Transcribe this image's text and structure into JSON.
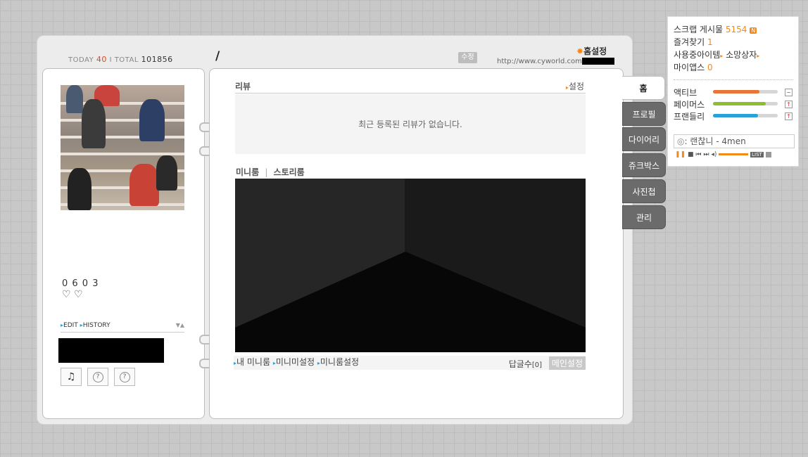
{
  "counter": {
    "today_label": "TODAY",
    "today_value": "40",
    "separator": "I",
    "total_label": "TOTAL",
    "total_value": "101856"
  },
  "header": {
    "slash": "/",
    "edit_label": "수정",
    "url": "http://www.cyworld.com",
    "home_setting_label": "홈설정"
  },
  "profile": {
    "mood_number": "0 6 0 3",
    "mood_hearts": "♡ ♡",
    "edit_label": "EDIT",
    "history_label": "HISTORY",
    "toggle": "▼▲"
  },
  "review": {
    "title": "리뷰",
    "setting_label": "설정",
    "empty_message": "최근 등록된 리뷰가 없습니다."
  },
  "miniroom": {
    "tab_miniroom": "미니룸",
    "divider": "|",
    "tab_storyroom": "스토리룸",
    "link_my_miniroom": "내 미니룸",
    "link_minimi_setting": "미니미설정",
    "link_miniroom_setting": "미니룸설정",
    "reply_count_label": "답글수",
    "reply_count": "[0]",
    "main_setting_label": "메인설정"
  },
  "tabs": [
    {
      "label": "홈",
      "active": true
    },
    {
      "label": "프로필",
      "active": false
    },
    {
      "label": "다이어리",
      "active": false
    },
    {
      "label": "쥬크박스",
      "active": false
    },
    {
      "label": "사진첩",
      "active": false
    },
    {
      "label": "관리",
      "active": false
    }
  ],
  "widget": {
    "scrap_label": "스크랩 게시물",
    "scrap_count": "5154",
    "new_badge": "N",
    "favorites_label": "즐겨찾기",
    "favorites_count": "1",
    "items_label": "사용중아이템",
    "wishbox_label": "소망상자",
    "myapps_label": "마이앱스",
    "myapps_count": "0",
    "stats": [
      {
        "label": "액티브",
        "level": 0.72,
        "color": "#e8743a",
        "button": "−"
      },
      {
        "label": "페이머스",
        "level": 0.82,
        "color": "#8cbf2e",
        "button": "↑"
      },
      {
        "label": "프랜들리",
        "level": 0.7,
        "color": "#2aa0d8",
        "button": "↑"
      }
    ],
    "now_playing": "랜찮니 - 4men",
    "list_label": "LIST"
  },
  "colors": {
    "accent_orange": "#f28a1a",
    "today_red": "#e8441a",
    "tab_gray": "#6b6b6b"
  }
}
